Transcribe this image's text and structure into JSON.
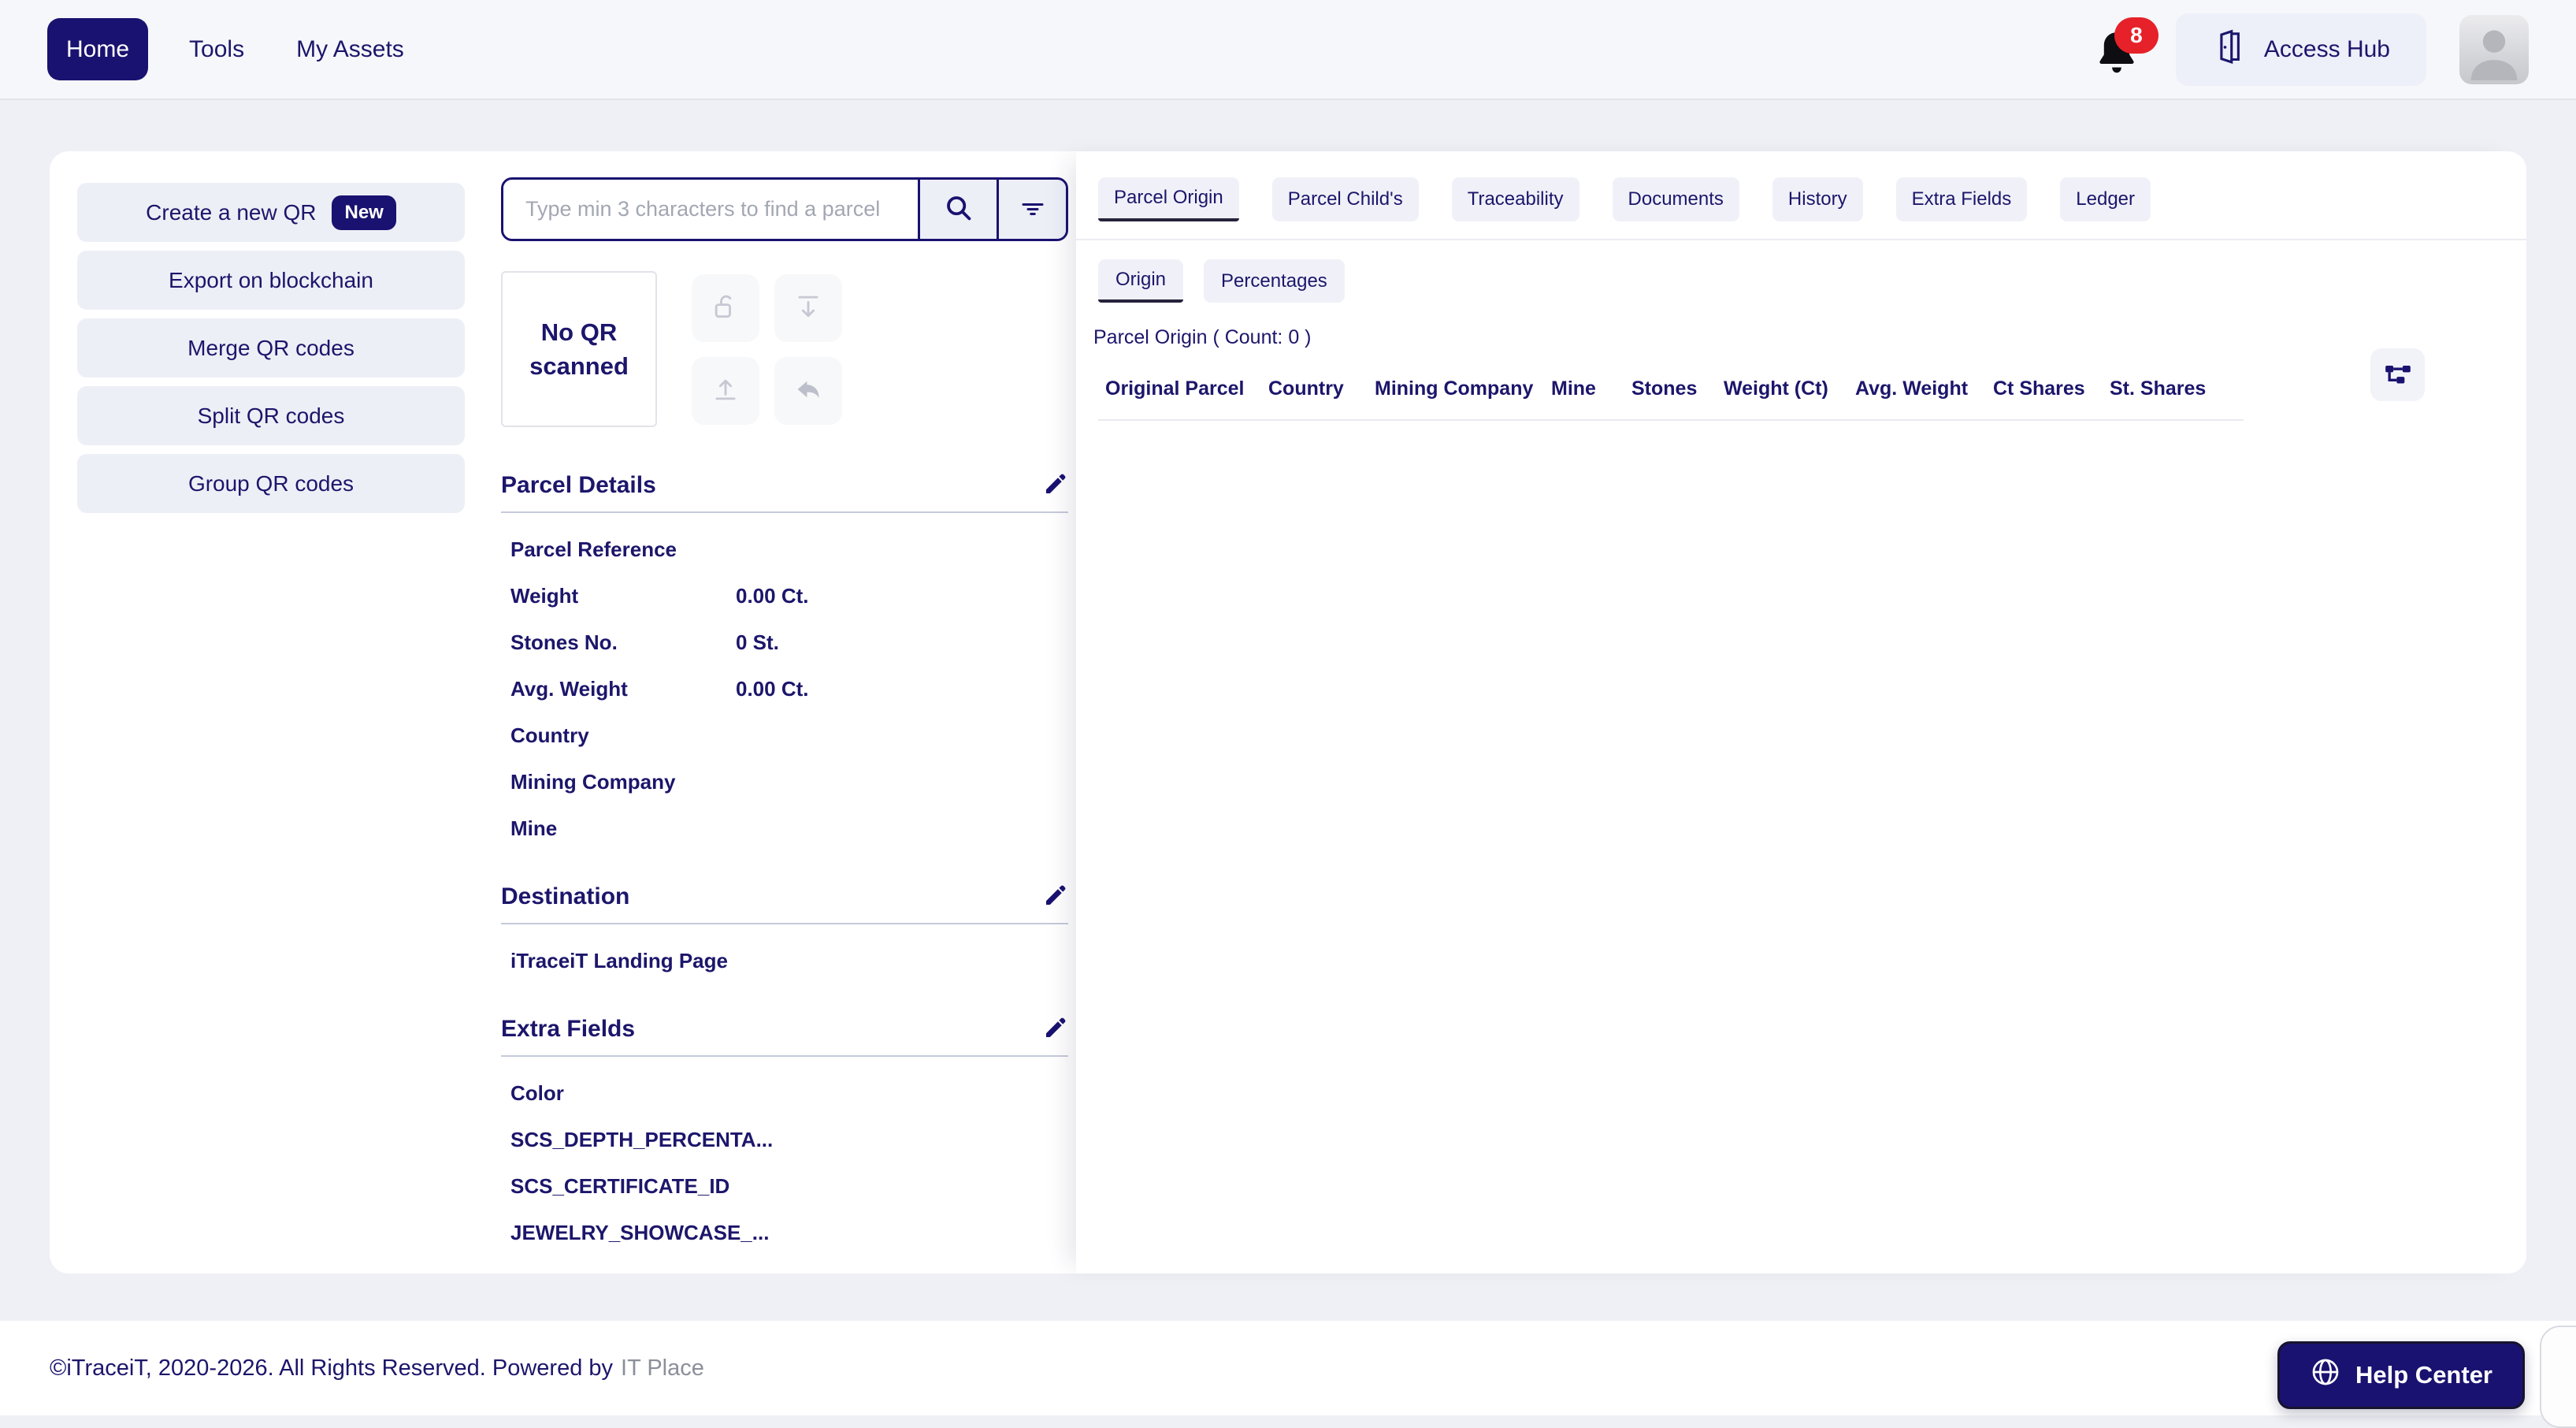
{
  "nav": {
    "items": [
      {
        "label": "Home"
      },
      {
        "label": "Tools"
      },
      {
        "label": "My Assets"
      }
    ],
    "notification_count": "8",
    "access_hub_label": "Access Hub"
  },
  "sidebar": {
    "actions": [
      {
        "label": "Create a new QR",
        "badge": "New"
      },
      {
        "label": "Export on blockchain"
      },
      {
        "label": "Merge QR codes"
      },
      {
        "label": "Split QR codes"
      },
      {
        "label": "Group QR codes"
      }
    ]
  },
  "scanner": {
    "search_placeholder": "Type min 3 characters to find a parcel",
    "no_qr_text": "No QR scanned"
  },
  "sections": {
    "parcel_details": {
      "title": "Parcel Details",
      "rows": [
        {
          "label": "Parcel Reference",
          "value": ""
        },
        {
          "label": "Weight",
          "value": "0.00 Ct."
        },
        {
          "label": "Stones No.",
          "value": "0 St."
        },
        {
          "label": "Avg. Weight",
          "value": "0.00 Ct."
        },
        {
          "label": "Country",
          "value": ""
        },
        {
          "label": "Mining Company",
          "value": ""
        },
        {
          "label": "Mine",
          "value": ""
        }
      ]
    },
    "destination": {
      "title": "Destination",
      "rows": [
        {
          "label": "iTraceiT Landing Page"
        }
      ]
    },
    "extra_fields": {
      "title": "Extra Fields",
      "rows": [
        {
          "label": "Color"
        },
        {
          "label": "SCS_DEPTH_PERCENTA..."
        },
        {
          "label": "SCS_CERTIFICATE_ID"
        },
        {
          "label": "JEWELRY_SHOWCASE_..."
        }
      ]
    }
  },
  "panel": {
    "tabs": [
      {
        "label": "Parcel Origin"
      },
      {
        "label": "Parcel Child's"
      },
      {
        "label": "Traceability"
      },
      {
        "label": "Documents"
      },
      {
        "label": "History"
      },
      {
        "label": "Extra Fields"
      },
      {
        "label": "Ledger"
      }
    ],
    "subtabs": [
      {
        "label": "Origin"
      },
      {
        "label": "Percentages"
      }
    ],
    "count_label": "Parcel Origin ( Count: 0 )",
    "table_headers": [
      "Original Parcel",
      "Country",
      "Mining Company",
      "Mine",
      "Stones",
      "Weight (Ct)",
      "Avg. Weight",
      "Ct Shares",
      "St. Shares"
    ]
  },
  "footer": {
    "copyright": "©iTraceiT, 2020-2026. All Rights Reserved. Powered by",
    "brand": "IT Place",
    "help_label": "Help Center"
  },
  "colors": {
    "accent_navy": "#1a1270",
    "badge_red": "#e62129",
    "panel_bg": "#f0f1f8"
  },
  "icons": {
    "notification": "bell-icon",
    "access_hub": "door-icon",
    "search": "magnifier-icon",
    "filter": "filter-lines-icon",
    "qr_actions": [
      "unlock-icon",
      "download-icon",
      "upload-icon",
      "undo-arrow-icon"
    ],
    "edit": "pencil-icon",
    "table_config": "node-graph-icon",
    "help": "globe-icon",
    "avatar": "person-icon"
  }
}
